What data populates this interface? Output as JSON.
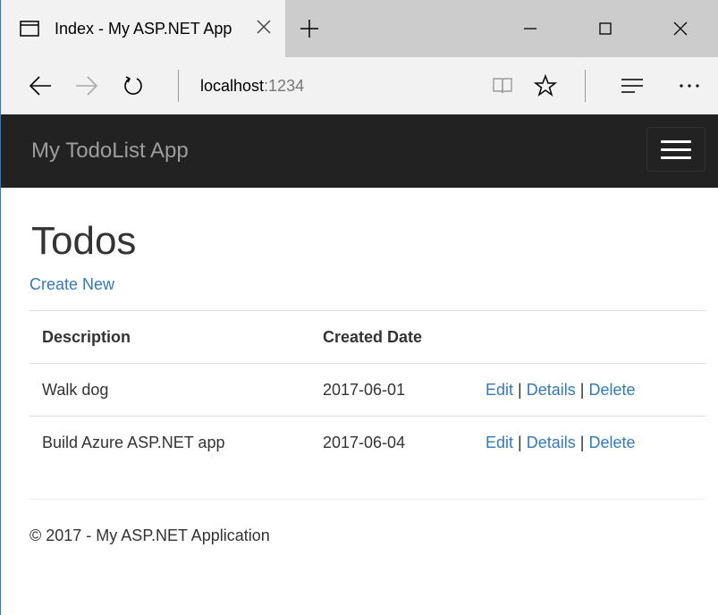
{
  "browser": {
    "tab_title": "Index - My ASP.NET App",
    "url_host": "localhost",
    "url_port": ":1234"
  },
  "navbar": {
    "brand": "My TodoList App"
  },
  "page": {
    "title": "Todos",
    "create_new": "Create New",
    "columns": [
      "Description",
      "Created Date"
    ],
    "rows": [
      {
        "description": "Walk dog",
        "created": "2017-06-01"
      },
      {
        "description": "Build Azure ASP.NET app",
        "created": "2017-06-04"
      }
    ],
    "actions": {
      "edit": "Edit",
      "details": "Details",
      "delete": "Delete",
      "separator": "|"
    }
  },
  "footer": {
    "text": "© 2017 - My ASP.NET Application"
  },
  "colors": {
    "link": "#337ab7",
    "navbar_bg": "#222222",
    "brand_text": "#9d9d9d"
  }
}
